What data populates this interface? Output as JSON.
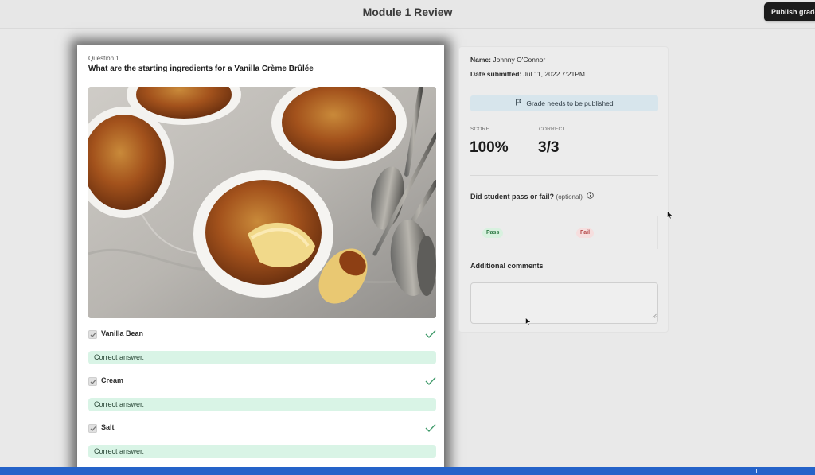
{
  "header": {
    "title": "Module 1 Review",
    "publish_label": "Publish grade"
  },
  "question": {
    "number_label": "Question 1",
    "text": "What are the starting ingredients for a Vanilla Crème Brûlée",
    "image_icon": "creme-brulee-photo",
    "answers": [
      {
        "label": "Vanilla Bean",
        "checked": true,
        "correct": true,
        "feedback": "Correct answer."
      },
      {
        "label": "Cream",
        "checked": true,
        "correct": true,
        "feedback": "Correct answer."
      },
      {
        "label": "Salt",
        "checked": true,
        "correct": true,
        "feedback": "Correct answer."
      }
    ]
  },
  "grading": {
    "name_label": "Name:",
    "name_value": "Johnny O'Connor",
    "date_label": "Date submitted:",
    "date_value": "Jul 11, 2022 7:21PM",
    "banner_text": "Grade needs to be published",
    "score_label": "SCORE",
    "score_value": "100%",
    "correct_label": "CORRECT",
    "correct_value": "3/3",
    "passfail_question": "Did student pass or fail?",
    "passfail_optional": "(optional)",
    "pass_label": "Pass",
    "fail_label": "Fail",
    "comments_label": "Additional comments",
    "comments_value": ""
  },
  "colors": {
    "correct_green": "#3f9a6a",
    "feedback_bg": "#d9f4e6",
    "banner_bg": "#d7e5ec",
    "taskbar": "#2563c9"
  }
}
